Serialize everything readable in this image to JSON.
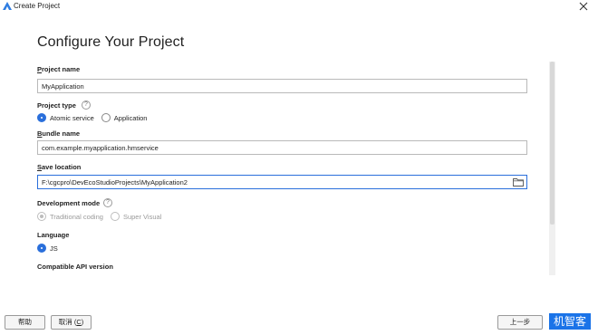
{
  "window": {
    "title": "Create Project",
    "close_icon": "close-icon",
    "logo_icon": "app-logo-icon"
  },
  "page": {
    "heading": "Configure Your Project"
  },
  "project_name": {
    "label_first": "P",
    "label_rest": "roject name",
    "value": "MyApplication"
  },
  "project_type": {
    "label": "Project type",
    "help_icon": "help-icon",
    "options": [
      {
        "label": "Atomic service",
        "checked": true
      },
      {
        "label": "Application",
        "checked": false
      }
    ]
  },
  "bundle_name": {
    "label_first": "B",
    "label_rest": "undle name",
    "value": "com.example.myapplication.hmservice"
  },
  "save_location": {
    "label_first": "S",
    "label_rest": "ave location",
    "value": "F:\\cgcpro\\DevEcoStudioProjects\\MyApplication2",
    "folder_icon": "folder-icon"
  },
  "development_mode": {
    "label": "Development mode",
    "help_icon": "help-icon",
    "options": [
      {
        "label": "Traditional coding",
        "checked": true,
        "disabled": true
      },
      {
        "label": "Super Visual",
        "checked": false,
        "disabled": true
      }
    ]
  },
  "language": {
    "label": "Language",
    "options": [
      {
        "label": "JS",
        "checked": true
      }
    ]
  },
  "compatible_api": {
    "label": "Compatible API version"
  },
  "footer": {
    "help_button": "帮助",
    "cancel_button_text": "取消 (",
    "cancel_button_key": "C",
    "cancel_button_end": ")",
    "previous_button_partial": "上一步",
    "watermark_text": "机智客"
  },
  "colors": {
    "accent": "#2a6fdb",
    "watermark_bg": "#1a73e8"
  }
}
